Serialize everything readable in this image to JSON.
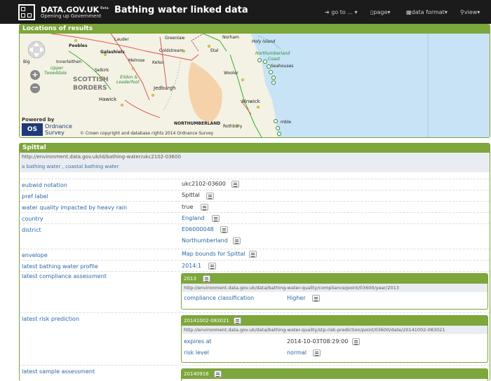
{
  "header": {
    "brand": "DATA.GOV.UK",
    "beta": "Beta",
    "tagline": "Opening up Government",
    "title": "Bathing water linked data",
    "nav": {
      "goto": "go to ...",
      "page": "page",
      "data_format": "data format",
      "view": "view"
    }
  },
  "map_panel": {
    "title": "Locations of results",
    "powered_by": "Powered by",
    "os_line1": "Ordnance",
    "os_line2": "Survey",
    "copyright": "© Crown copyright and database rights 2014 Ordnance Survey",
    "labels": [
      "Peebles",
      "Lauder",
      "Greenlaw",
      "Norham",
      "Holy Island",
      "Galashiels",
      "Coldstream",
      "Etal",
      "Innerleithen",
      "Melrose",
      "Kelso",
      "Northumberland",
      "Coast",
      "Seahouses",
      "Upper",
      "Tweeddale",
      "Selkirk",
      "Eildon &",
      "Leaderfoot",
      "SCOTTISH",
      "BORDERS",
      "Jedburgh",
      "Wooler",
      "Hawick",
      "Alnwick",
      "NORTHUMBERLAND",
      "Rothbury",
      "mble",
      "Big"
    ]
  },
  "detail": {
    "title": "Spittal",
    "uri": "http://environment.data.gov.uk/id/bathing-water/ukc2102-03600",
    "type_1": "a bathing water",
    "type_sep": ",",
    "type_2": "coastal bathing water",
    "rows": {
      "eubwid_label": "eubwid notation",
      "eubwid_value": "ukc2102-03600",
      "pref_label": "pref label",
      "pref_value": "Spittal",
      "heavy_rain_label": "water quality impacted by heavy rain",
      "heavy_rain_value": "true",
      "country_label": "country",
      "country_value": "England",
      "district_label": "district",
      "district_value_1": "E06000048",
      "district_value_2": "Northumberland",
      "envelope_label": "envelope",
      "envelope_value": "Map bounds for Spittal",
      "profile_label": "latest bathing water profile",
      "profile_value": "2014:1",
      "compliance_label": "latest compliance assessment",
      "risk_label": "latest risk prediction",
      "sample_label": "latest sample assessment"
    },
    "compliance": {
      "head": "2013",
      "uri": "http://environment.data.gov.uk/data/bathing-water-quality/compliance/point/03600/year/2013",
      "class_label": "compliance classification",
      "class_value": "Higher"
    },
    "risk": {
      "head": "20141002-083021",
      "uri": "http://environment.data.gov.uk/data/bathing-water-quality/stp-risk-prediction/point/03600/date/20141002-083021",
      "expires_label": "expires at",
      "expires_value": "2014-10-03T08:29:00",
      "level_label": "risk level",
      "level_value": "normal"
    },
    "sample": {
      "head": "20140916"
    }
  }
}
